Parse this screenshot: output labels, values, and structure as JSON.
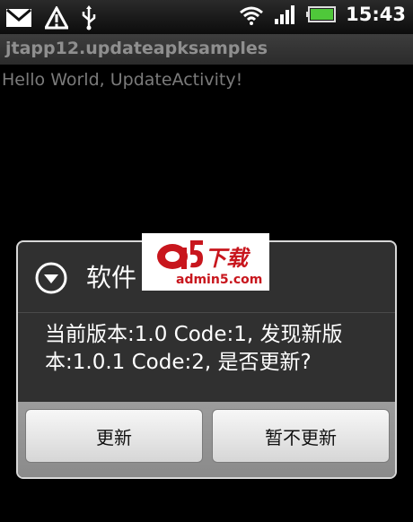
{
  "status_bar": {
    "time": "15:43",
    "icons": [
      "mail-icon",
      "warning-icon",
      "usb-icon",
      "wifi-icon",
      "signal-icon",
      "battery-icon"
    ]
  },
  "app": {
    "title": "jtapp12.updateapksamples",
    "content_text": "Hello World, UpdateActivity!"
  },
  "dialog": {
    "title": "软件",
    "message": "当前版本:1.0 Code:1, 发现新版本:1.0.1 Code:2, 是否更新?",
    "buttons": {
      "update": "更新",
      "later": "暂不更新"
    }
  },
  "watermark": {
    "logo": "a5",
    "logo_cn": "下载",
    "url": "admin5.com"
  },
  "colors": {
    "battery": "#4fc83a",
    "watermark_red": "#c8161d"
  }
}
